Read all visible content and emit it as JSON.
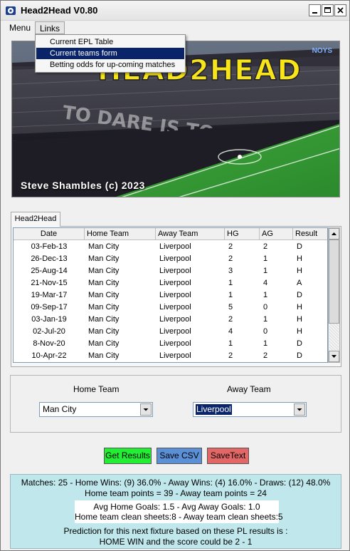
{
  "window": {
    "title": "Head2Head V0.80"
  },
  "menubar": {
    "items": [
      "Menu",
      "Links"
    ]
  },
  "links_menu": {
    "items": [
      {
        "label": "Current EPL Table"
      },
      {
        "label": "Current teams form"
      },
      {
        "label": "Betting odds for up-coming matches"
      }
    ],
    "highlighted_index": 1
  },
  "banner": {
    "logo": "HEAD2HEAD",
    "credit": "Steve Shambles (c) 2023",
    "sponsor": "NOYS"
  },
  "tab": {
    "label": "Head2Head"
  },
  "table": {
    "columns": [
      "Date",
      "Home Team",
      "Away Team",
      "HG",
      "AG",
      "Result"
    ],
    "rows": [
      [
        "03-Feb-13",
        "Man City",
        "Liverpool",
        "2",
        "2",
        "D"
      ],
      [
        "26-Dec-13",
        "Man City",
        "Liverpool",
        "2",
        "1",
        "H"
      ],
      [
        "25-Aug-14",
        "Man City",
        "Liverpool",
        "3",
        "1",
        "H"
      ],
      [
        "21-Nov-15",
        "Man City",
        "Liverpool",
        "1",
        "4",
        "A"
      ],
      [
        "19-Mar-17",
        "Man City",
        "Liverpool",
        "1",
        "1",
        "D"
      ],
      [
        "09-Sep-17",
        "Man City",
        "Liverpool",
        "5",
        "0",
        "H"
      ],
      [
        "03-Jan-19",
        "Man City",
        "Liverpool",
        "2",
        "1",
        "H"
      ],
      [
        "02-Jul-20",
        "Man City",
        "Liverpool",
        "4",
        "0",
        "H"
      ],
      [
        "8-Nov-20",
        "Man City",
        "Liverpool",
        "1",
        "1",
        "D"
      ],
      [
        "10-Apr-22",
        "Man City",
        "Liverpool",
        "2",
        "2",
        "D"
      ]
    ]
  },
  "team_select": {
    "home_label": "Home Team",
    "away_label": "Away Team",
    "home_value": "Man City",
    "away_value": "Liverpool"
  },
  "buttons": {
    "get_results": "Get Results",
    "save_csv": "Save  CSV",
    "save_text": "SaveText"
  },
  "stats": {
    "line1": "Matches: 25  -  Home Wins: (9) 36.0%  -  Away Wins: (4) 16.0%  -  Draws: (12) 48.0%",
    "line2": "Home team points = 39 - Away team points = 24",
    "avg_goals": "Avg Home Goals: 1.5 - Avg Away Goals: 1.0",
    "clean_sheets": "Home team clean sheets:8 - Away team clean sheets:5",
    "prediction_1": "Prediction for this next fixture based on these PL results is :",
    "prediction_2": "HOME WIN and the score could be 2 - 1"
  },
  "colors": {
    "get_results_bg": "#22ee33",
    "save_csv_bg": "#5b8fd6",
    "save_text_bg": "#e36767",
    "stats_bg": "#bfe7ec",
    "menu_highlight": "#0a246a"
  }
}
